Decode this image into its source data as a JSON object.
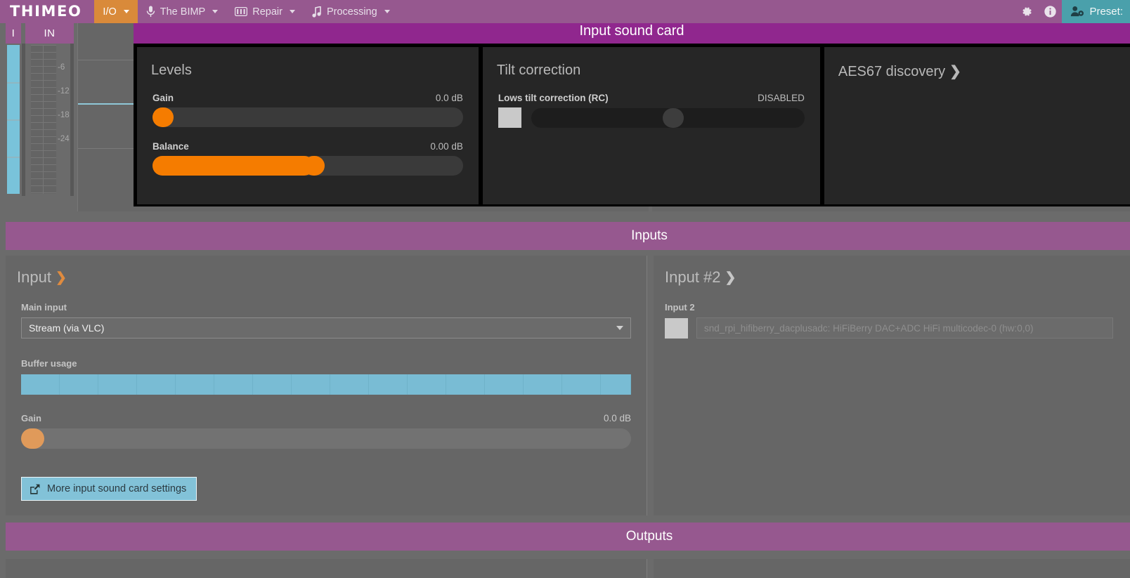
{
  "topbar": {
    "brand": "THIMEO",
    "menus": [
      {
        "label": "I/O",
        "icon": "",
        "active": true,
        "caret": true
      },
      {
        "label": "The BIMP",
        "icon": "microphone-icon",
        "active": false,
        "caret": true
      },
      {
        "label": "Repair",
        "icon": "equalizer-icon",
        "active": false,
        "caret": true
      },
      {
        "label": "Processing",
        "icon": "music-note-icon",
        "active": false,
        "caret": true
      }
    ],
    "gear_icon": "gear-icon",
    "info_icon": "info-icon",
    "preset_label": "Preset:",
    "preset_icon": "user-settings-icon",
    "accent": "#96588f",
    "active_accent": "#d98a3a",
    "preset_bg": "#4aa0ab"
  },
  "meters": {
    "columns": [
      {
        "name": "I",
        "header": "I"
      },
      {
        "name": "IN",
        "header": "IN"
      }
    ],
    "scale_labels": [
      "-6",
      "-12",
      "-18",
      "-24"
    ],
    "bar_color": "#79c3da"
  },
  "modal": {
    "title": "Input sound card",
    "title_bg": "#90278e",
    "cards": [
      {
        "title": "Levels",
        "controls": [
          {
            "label": "Gain",
            "value": "0.0 dB",
            "fill_pct": 0,
            "knob_pct": 0,
            "disabled": false
          },
          {
            "label": "Balance",
            "value": "0.00 dB",
            "fill_pct": 50,
            "knob_pct": 50,
            "disabled": false
          }
        ]
      },
      {
        "title": "Tilt correction",
        "controls": [
          {
            "label": "Lows tilt correction (RC)",
            "value": "DISABLED",
            "fill_pct": 0,
            "knob_pct": 48,
            "disabled": true,
            "checkbox": true
          }
        ]
      },
      {
        "title": "AES67 discovery",
        "chevron": "chevron-right-icon",
        "controls": []
      }
    ]
  },
  "sections": {
    "inputs_banner": "Inputs",
    "outputs_banner": "Outputs"
  },
  "input_panel": {
    "header": "Input",
    "header_chevron": "chevron-down-icon",
    "main_input_label": "Main input",
    "main_input_value": "Stream (via VLC)",
    "buffer_label": "Buffer usage",
    "buffer_pct": 100,
    "gain_label": "Gain",
    "gain_value": "0.0 dB",
    "gain_pct": 0,
    "more_button": "More input sound card settings",
    "more_button_icon": "external-link-icon"
  },
  "input2_panel": {
    "header": "Input #2",
    "header_chevron": "chevron-right-icon",
    "field_label": "Input 2",
    "device_value": "snd_rpi_hifiberry_dacplusadc: HiFiBerry DAC+ADC HiFi multicodec-0 (hw:0,0)"
  }
}
